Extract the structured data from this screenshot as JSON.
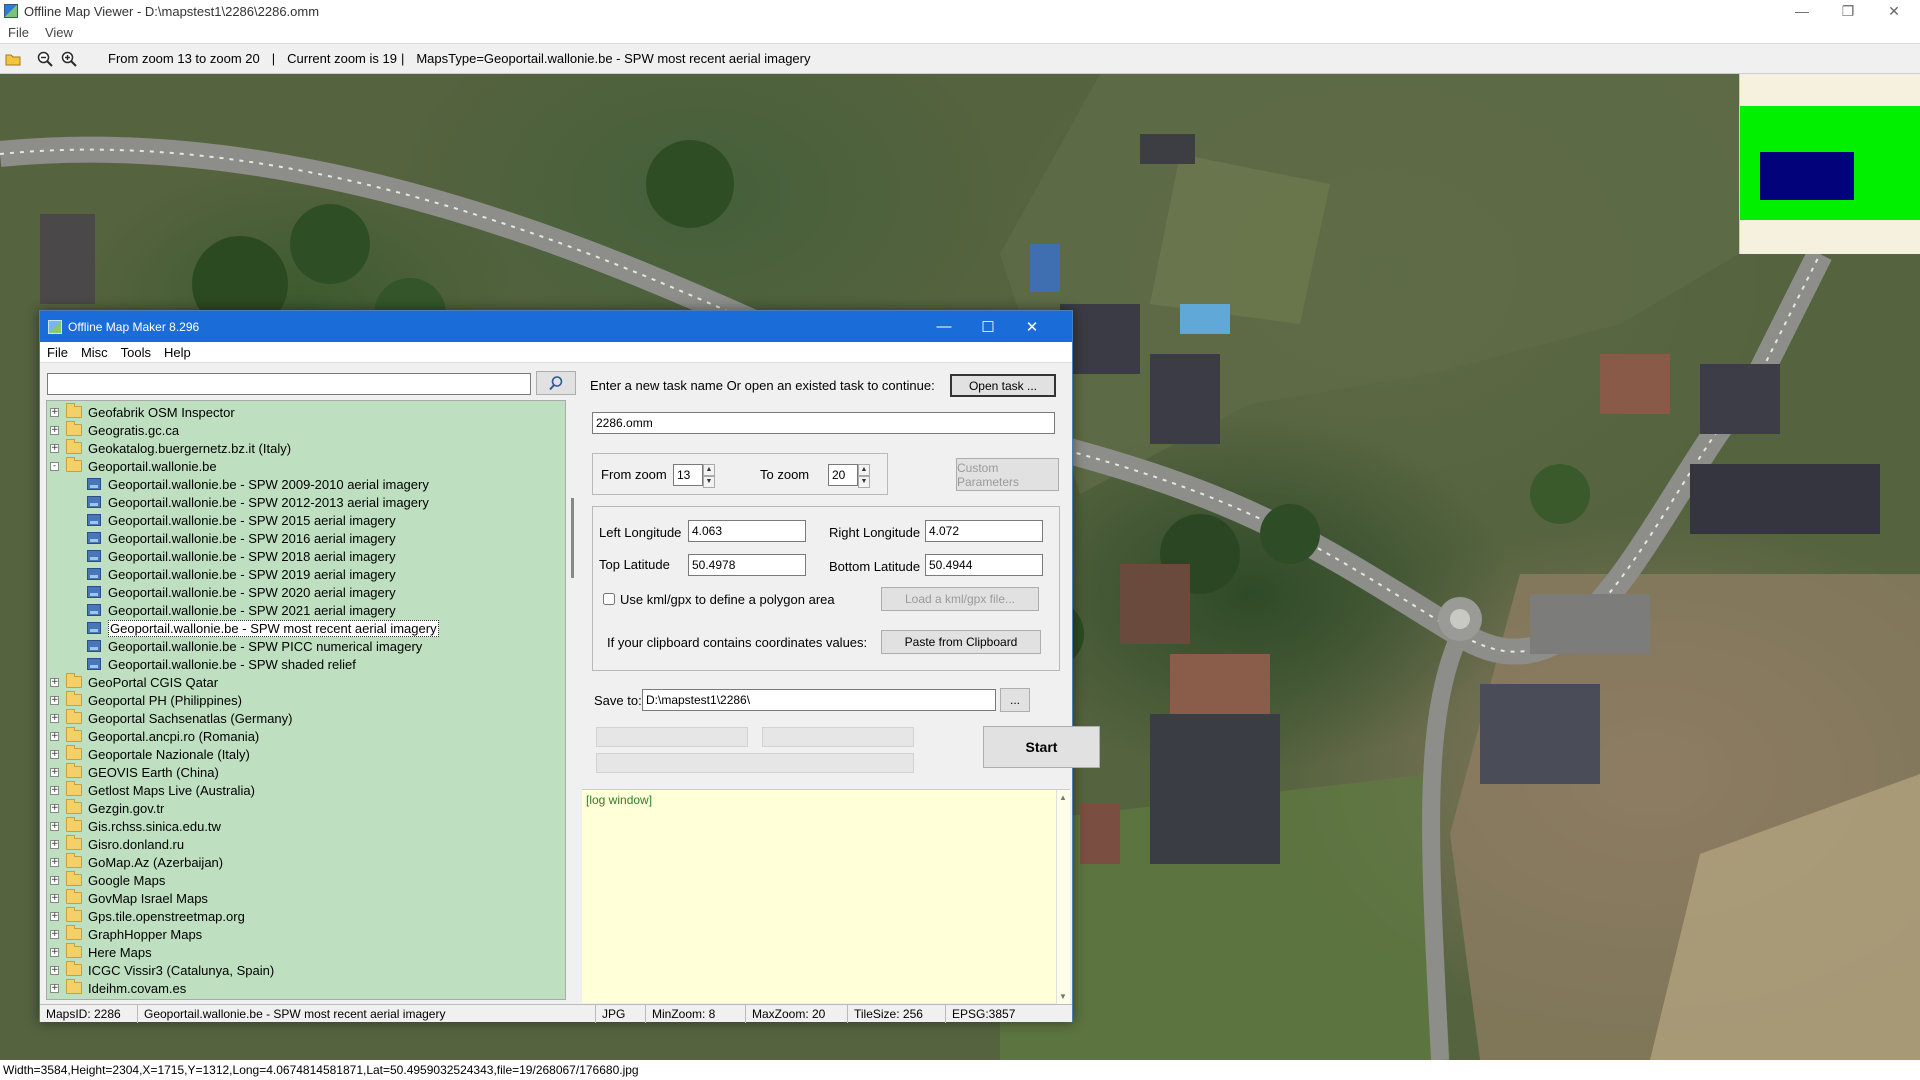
{
  "viewer": {
    "title": "Offline Map Viewer - D:\\mapstest1\\2286\\2286.omm",
    "menu": [
      "File",
      "View"
    ],
    "toolbar": {
      "zoom_range": "From zoom 13 to zoom 20",
      "sep1": "|",
      "current_zoom": "Current zoom is 19",
      "sep2": "|",
      "maps_type": "MapsType=Geoportail.wallonie.be - SPW most recent aerial imagery"
    },
    "status": "Width=3584,Height=2304,X=1715,Y=1312,Long=4.0674814581871,Lat=50.4959032524343,file=19/268067/176680.jpg",
    "minimap_colors": {
      "background": "#f6f1de",
      "view": "#00f000",
      "selection": "#02037a"
    }
  },
  "omm": {
    "title": "Offline Map Maker 8.296",
    "menu": [
      "File",
      "Misc",
      "Tools",
      "Help"
    ],
    "search": {
      "value": "",
      "placeholder": ""
    },
    "tree": [
      {
        "label": "Geofabrik OSM Inspector",
        "type": "folder",
        "level": 0,
        "expander": "+"
      },
      {
        "label": "Geogratis.gc.ca",
        "type": "folder",
        "level": 0,
        "expander": "+"
      },
      {
        "label": "Geokatalog.buergernetz.bz.it (Italy)",
        "type": "folder",
        "level": 0,
        "expander": "+"
      },
      {
        "label": "Geoportail.wallonie.be",
        "type": "folder",
        "level": 0,
        "expander": "-"
      },
      {
        "label": "Geoportail.wallonie.be - SPW 2009-2010 aerial imagery",
        "type": "leaf",
        "level": 1
      },
      {
        "label": "Geoportail.wallonie.be - SPW 2012-2013 aerial imagery",
        "type": "leaf",
        "level": 1
      },
      {
        "label": "Geoportail.wallonie.be - SPW 2015 aerial imagery",
        "type": "leaf",
        "level": 1
      },
      {
        "label": "Geoportail.wallonie.be - SPW 2016 aerial imagery",
        "type": "leaf",
        "level": 1
      },
      {
        "label": "Geoportail.wallonie.be - SPW 2018 aerial imagery",
        "type": "leaf",
        "level": 1
      },
      {
        "label": "Geoportail.wallonie.be - SPW 2019 aerial imagery",
        "type": "leaf",
        "level": 1
      },
      {
        "label": "Geoportail.wallonie.be - SPW 2020 aerial imagery",
        "type": "leaf",
        "level": 1
      },
      {
        "label": "Geoportail.wallonie.be - SPW 2021 aerial imagery",
        "type": "leaf",
        "level": 1
      },
      {
        "label": "Geoportail.wallonie.be - SPW most recent aerial imagery",
        "type": "leaf",
        "level": 1,
        "selected": true
      },
      {
        "label": "Geoportail.wallonie.be - SPW PICC numerical imagery",
        "type": "leaf",
        "level": 1
      },
      {
        "label": "Geoportail.wallonie.be - SPW shaded relief",
        "type": "leaf",
        "level": 1
      },
      {
        "label": "GeoPortal CGIS Qatar",
        "type": "folder",
        "level": 0,
        "expander": "+"
      },
      {
        "label": "Geoportal PH (Philippines)",
        "type": "folder",
        "level": 0,
        "expander": "+"
      },
      {
        "label": "Geoportal Sachsenatlas (Germany)",
        "type": "folder",
        "level": 0,
        "expander": "+"
      },
      {
        "label": "Geoportal.ancpi.ro (Romania)",
        "type": "folder",
        "level": 0,
        "expander": "+"
      },
      {
        "label": "Geoportale Nazionale (Italy)",
        "type": "folder",
        "level": 0,
        "expander": "+"
      },
      {
        "label": "GEOVIS Earth (China)",
        "type": "folder",
        "level": 0,
        "expander": "+"
      },
      {
        "label": "Getlost Maps Live (Australia)",
        "type": "folder",
        "level": 0,
        "expander": "+"
      },
      {
        "label": "Gezgin.gov.tr",
        "type": "folder",
        "level": 0,
        "expander": "+"
      },
      {
        "label": "Gis.rchss.sinica.edu.tw",
        "type": "folder",
        "level": 0,
        "expander": "+"
      },
      {
        "label": "Gisro.donland.ru",
        "type": "folder",
        "level": 0,
        "expander": "+"
      },
      {
        "label": "GoMap.Az (Azerbaijan)",
        "type": "folder",
        "level": 0,
        "expander": "+"
      },
      {
        "label": "Google Maps",
        "type": "folder",
        "level": 0,
        "expander": "+"
      },
      {
        "label": "GovMap Israel Maps",
        "type": "folder",
        "level": 0,
        "expander": "+"
      },
      {
        "label": "Gps.tile.openstreetmap.org",
        "type": "folder",
        "level": 0,
        "expander": "+"
      },
      {
        "label": "GraphHopper Maps",
        "type": "folder",
        "level": 0,
        "expander": "+"
      },
      {
        "label": "Here Maps",
        "type": "folder",
        "level": 0,
        "expander": "+"
      },
      {
        "label": "ICGC Vissir3 (Catalunya, Spain)",
        "type": "folder",
        "level": 0,
        "expander": "+"
      },
      {
        "label": "Ideihm.covam.es",
        "type": "folder",
        "level": 0,
        "expander": "+"
      }
    ],
    "task": {
      "prompt": "Enter a new task name Or open an existed task to continue:",
      "open_button": "Open task ...",
      "name": "2286.omm"
    },
    "zoom": {
      "from_label": "From zoom",
      "from_value": "13",
      "to_label": "To zoom",
      "to_value": "20",
      "custom_button": "Custom Parameters"
    },
    "coords": {
      "left_lon_label": "Left Longitude",
      "left_lon": "4.063",
      "right_lon_label": "Right Longitude",
      "right_lon": "4.072",
      "top_lat_label": "Top Latitude",
      "top_lat": "50.4978",
      "bottom_lat_label": "Bottom Latitude",
      "bottom_lat": "50.4944",
      "kml_checkbox_label": "Use kml/gpx to define a polygon area",
      "kml_checked": false,
      "load_kml_button": "Load a kml/gpx file...",
      "clipboard_label": "If your clipboard contains coordinates values:",
      "paste_button": "Paste from Clipboard"
    },
    "save": {
      "label": "Save to:",
      "path": "D:\\mapstest1\\2286\\",
      "browse_button": "...",
      "start_button": "Start"
    },
    "log": {
      "text": "[log window]"
    },
    "status": {
      "maps_id": "MapsID: 2286",
      "maps_name": "Geoportail.wallonie.be - SPW most recent aerial imagery",
      "format": "JPG",
      "min_zoom": "MinZoom: 8",
      "max_zoom": "MaxZoom: 20",
      "tile_size": "TileSize: 256",
      "epsg": "EPSG:3857"
    }
  }
}
